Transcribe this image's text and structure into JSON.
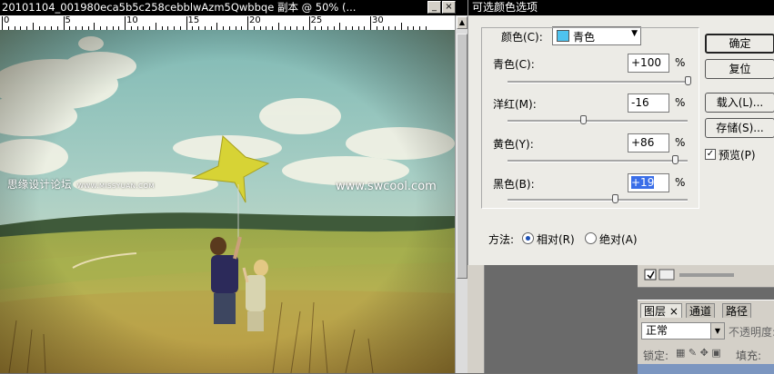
{
  "document": {
    "title": "20101104_001980eca5b5c258cebblwAzm5Qwbbqe 副本 @ 50% (...",
    "ruler_labels": [
      "0",
      "5",
      "10",
      "15",
      "20",
      "25",
      "30"
    ],
    "watermark_left": "思缘设计论坛",
    "watermark_left_small": "WWW.MISSYUAN.COM",
    "watermark_right": "www.swcool.com"
  },
  "dialog": {
    "title": "可选颜色选项",
    "color_label": "颜色(C):",
    "color_value": "青色",
    "swatch_color": "#4ec3ef",
    "sliders": [
      {
        "label": "青色(C):",
        "value": "+100",
        "percent": 100
      },
      {
        "label": "洋红(M):",
        "value": "-16",
        "percent": -16
      },
      {
        "label": "黄色(Y):",
        "value": "+86",
        "percent": 86
      },
      {
        "label": "黑色(B):",
        "value": "+19",
        "percent": 19
      }
    ],
    "percent_sign": "%",
    "buttons": {
      "ok": "确定",
      "reset": "复位",
      "load": "载入(L)...",
      "save": "存储(S)..."
    },
    "preview_label": "预览(P)",
    "preview_checked": true,
    "method_label": "方法:",
    "method_relative": "相对(R)",
    "method_absolute": "绝对(A)",
    "method_selected": "relative"
  },
  "layers_panel": {
    "tabs": [
      "图层",
      "通道",
      "路径"
    ],
    "tab_close": "×",
    "blend_mode": "正常",
    "opacity_label": "不透明度:",
    "lock_label": "锁定:",
    "fill_label": "填充:"
  }
}
